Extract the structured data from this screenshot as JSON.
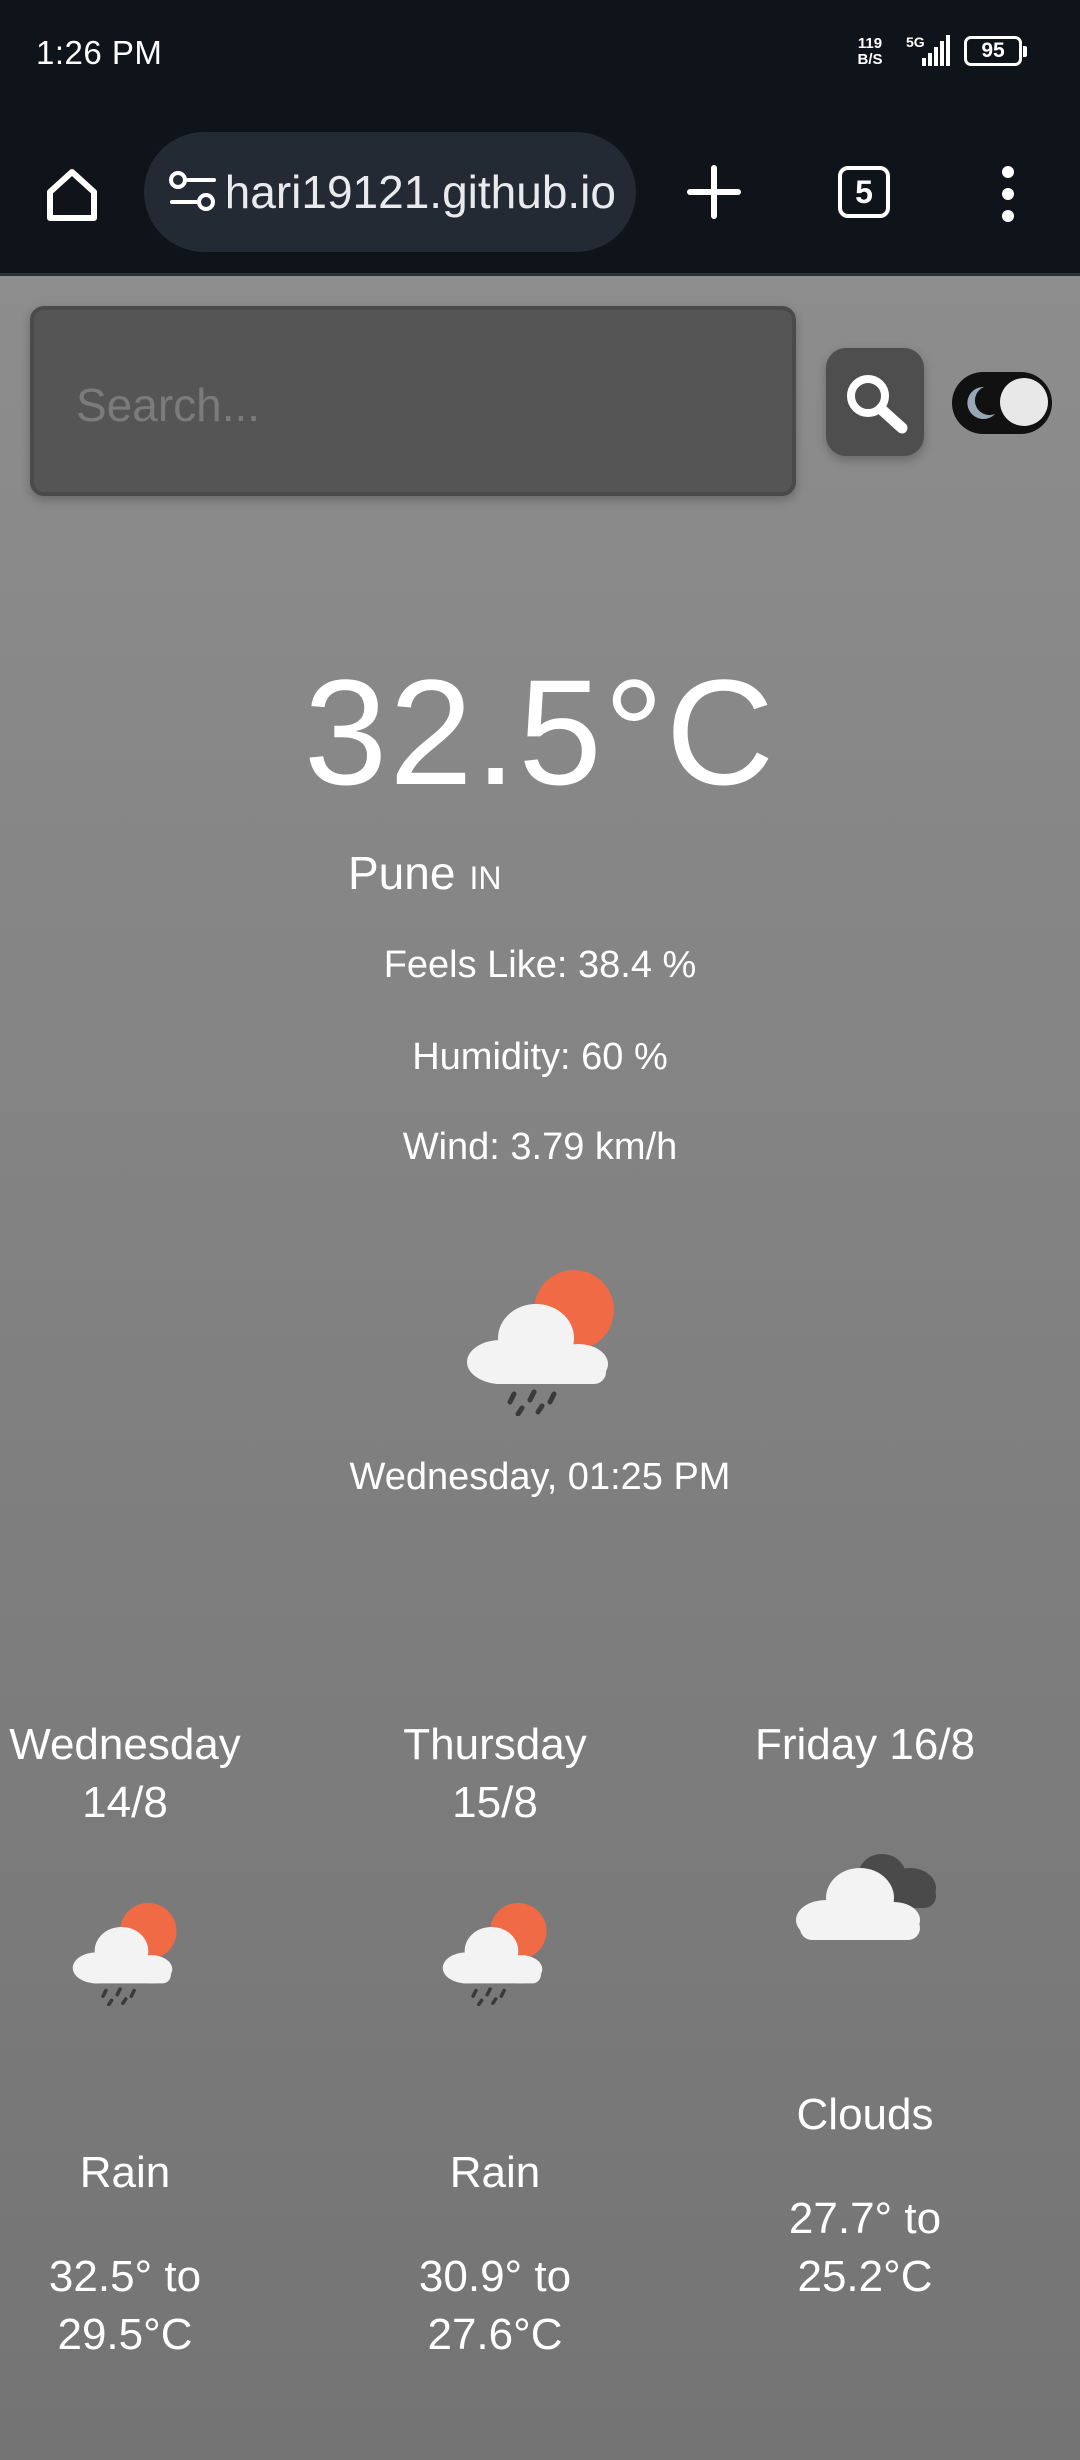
{
  "status_bar": {
    "time": "1:26 PM",
    "net_speed_value": "119",
    "net_speed_unit": "B/S",
    "network": "5G",
    "battery": "95"
  },
  "browser": {
    "url": "hari19121.github.io",
    "tab_count": "5"
  },
  "search": {
    "placeholder": "Search..."
  },
  "current": {
    "temperature": "32.5°C",
    "city": "Pune",
    "country": "IN",
    "feels_like": "Feels Like: 38.4 %",
    "humidity": "Humidity: 60 %",
    "wind": "Wind: 3.79 km/h",
    "icon": "rain-sun-cloud-icon",
    "datetime": "Wednesday, 01:25 PM"
  },
  "forecast": [
    {
      "day": "Wednesday",
      "date": "14/8",
      "icon": "rain-sun-cloud-icon",
      "description": "Rain",
      "range_line1": "32.5° to",
      "range_line2": "29.5°C"
    },
    {
      "day": "Thursday",
      "date": "15/8",
      "icon": "rain-sun-cloud-icon",
      "description": "Rain",
      "range_line1": "30.9° to",
      "range_line2": "27.6°C"
    },
    {
      "day": "Friday",
      "date": "16/8",
      "icon": "clouds-icon",
      "description": "Clouds",
      "range_line1": "27.7° to",
      "range_line2": "25.2°C"
    }
  ],
  "colors": {
    "status_bar_bg": "#0f141b",
    "content_bg": "#8d8d8d",
    "sun_orange": "#f06a45"
  }
}
